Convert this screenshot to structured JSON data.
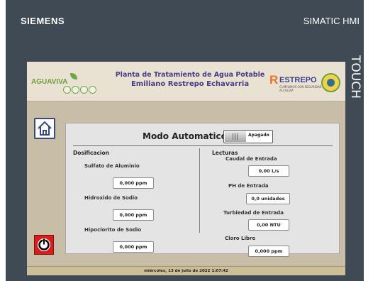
{
  "device": {
    "brand": "SIEMENS",
    "product": "SIMATIC HMI",
    "side_label": "TOUCH"
  },
  "banner": {
    "left_logo_text": "AGUAVIVA",
    "title_line1": "Planta de Tratamiento de Agua Potable",
    "title_line2": "Emiliano Restrepo Echavarria",
    "right_logo_text": "ESTREPO",
    "right_logo_r": "R",
    "right_logo_subtext": "CUMPLIMOS CON SEGURIDAD",
    "right_logo_alcaldia": "ALCALDIA"
  },
  "mode": {
    "title": "Modo Automatico",
    "toggle_state": "Apagado"
  },
  "dosificacion": {
    "header": "Dosificacion",
    "items": [
      {
        "label": "Sulfato de Aluminio",
        "value": "0,000 ppm"
      },
      {
        "label": "Hidroxido de Sodio",
        "value": "0,000 ppm"
      },
      {
        "label": "Hipoclorito de Sodio",
        "value": "0,000 ppm"
      }
    ]
  },
  "lecturas": {
    "header": "Lecturas",
    "items": [
      {
        "label": "Caudal de Entrada",
        "value": "0,00 L/s"
      },
      {
        "label": "PH  de Entrada",
        "value": "0,0 unidades"
      },
      {
        "label": "Turbiedad  de Entrada",
        "value": "0,00 NTU"
      },
      {
        "label": "Cloro Libre",
        "value": "0,000 ppm"
      }
    ]
  },
  "status_bar": {
    "datetime": "miércoles, 13 de julio de 2022 1:07:42"
  },
  "colors": {
    "frame": "#3f4a55",
    "screen_bg": "#c8bda6",
    "title_purple": "#4a3b87",
    "power_red": "#d91d1d",
    "accent_orange": "#e8742a"
  },
  "icons": {
    "home": "home-icon",
    "power": "power-icon"
  }
}
